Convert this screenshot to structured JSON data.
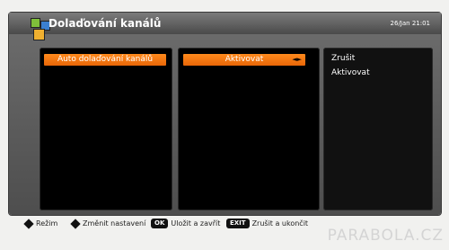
{
  "header": {
    "title": "Dolaďování kanálů",
    "datetime": "26/Jan 21:01"
  },
  "panels": {
    "mode": {
      "selected_label": "Auto dolaďování kanálů"
    },
    "setting": {
      "selected_label": "Aktivovat",
      "arrows": "◄►"
    },
    "options": [
      {
        "label": "Zrušit"
      },
      {
        "label": "Aktivovat"
      }
    ]
  },
  "footer": {
    "mode_label": "Režim",
    "change_label": "Změnit nastavení",
    "ok_key": "OK",
    "ok_label": "Uložit a zavřít",
    "exit_key": "EXIT",
    "exit_label": "Zrušit a ukončit"
  },
  "watermark": "PARABOLA.CZ",
  "colors": {
    "highlight": "#f47a10",
    "panel_bg": "#000000",
    "frame_bg": "#5f5f5f"
  }
}
